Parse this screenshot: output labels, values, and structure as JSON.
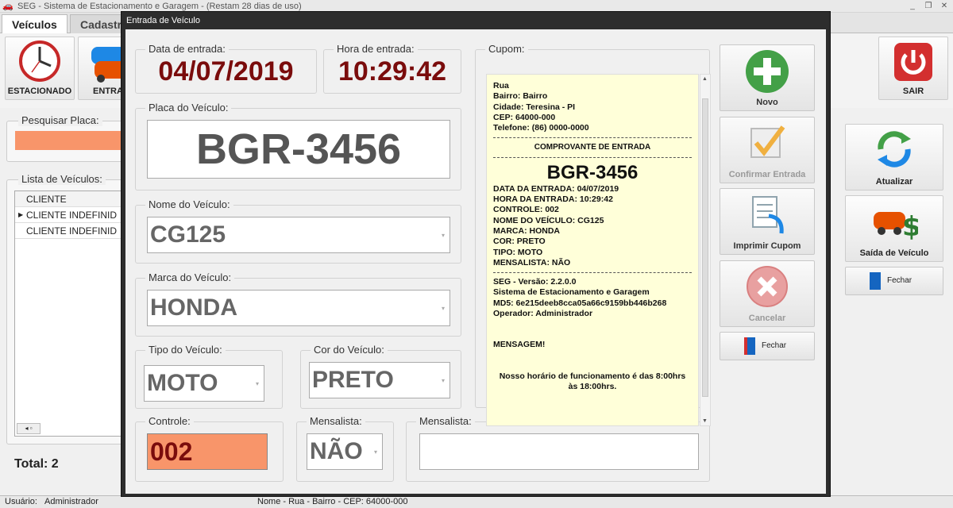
{
  "app": {
    "title": "SEG - Sistema de Estacionamento e Garagem  - (Restam 28 dias de uso)",
    "tabs": [
      "Veículos",
      "Cadastr"
    ],
    "ribbon": {
      "estacionado": "ESTACIONADO",
      "entrada": "ENTRA",
      "sair": "SAIR"
    },
    "search_label": "Pesquisar Placa:",
    "list_label": "Lista de Veículos:",
    "list_header": "CLIENTE",
    "list_rows": [
      "CLIENTE INDEFINID",
      "CLIENTE INDEFINID"
    ],
    "total": "Total: 2",
    "side_buttons": {
      "atualizar": "Atualizar",
      "saida": "Saída de Veículo",
      "fechar": "Fechar"
    },
    "status": {
      "usuario_label": "Usuário:",
      "usuario": "Administrador",
      "endereco": "Nome - Rua - Bairro - CEP: 64000-000"
    }
  },
  "dialog": {
    "title": "Entrada de Veículo",
    "data_label": "Data de entrada:",
    "data": "04/07/2019",
    "hora_label": "Hora de entrada:",
    "hora": "10:29:42",
    "placa_label": "Placa do Veículo:",
    "placa": "BGR-3456",
    "nome_label": "Nome do Veículo:",
    "nome": "CG125",
    "marca_label": "Marca do Veículo:",
    "marca": "HONDA",
    "tipo_label": "Tipo do Veículo:",
    "tipo": "MOTO",
    "cor_label": "Cor do Veículo:",
    "cor": "PRETO",
    "controle_label": "Controle:",
    "controle": "002",
    "mensalista_label": "Mensalista:",
    "mensalista": "NÃO",
    "mensalista2_label": "Mensalista:",
    "mensalista2": "",
    "cupom_label": "Cupom:",
    "cupom": {
      "header": [
        "Rua",
        "Bairro: Bairro",
        "Cidade: Teresina - PI",
        "CEP: 64000-000",
        "Telefone: (86) 0000-0000"
      ],
      "comprovante": "COMPROVANTE DE ENTRADA",
      "placa": "BGR-3456",
      "details": [
        "DATA DA ENTRADA: 04/07/2019",
        "HORA DA ENTRADA: 10:29:42",
        "CONTROLE: 002",
        "NOME DO VEÍCULO: CG125",
        "MARCA: HONDA",
        "COR: PRETO",
        "TIPO: MOTO",
        "MENSALISTA: NÃO"
      ],
      "footer": [
        "SEG - Versão: 2.2.0.0",
        "Sistema de Estacionamento e Garagem",
        "MD5: 6e215deeb8cca05a66c9159bb446b268",
        "Operador: Administrador"
      ],
      "mensagem": "MENSAGEM!",
      "horario": "Nosso horário de funcionamento é das 8:00hrs às 18:00hrs."
    },
    "buttons": {
      "novo": "Novo",
      "confirmar": "Confirmar Entrada",
      "imprimir": "Imprimir Cupom",
      "cancelar": "Cancelar",
      "fechar": "Fechar"
    }
  }
}
